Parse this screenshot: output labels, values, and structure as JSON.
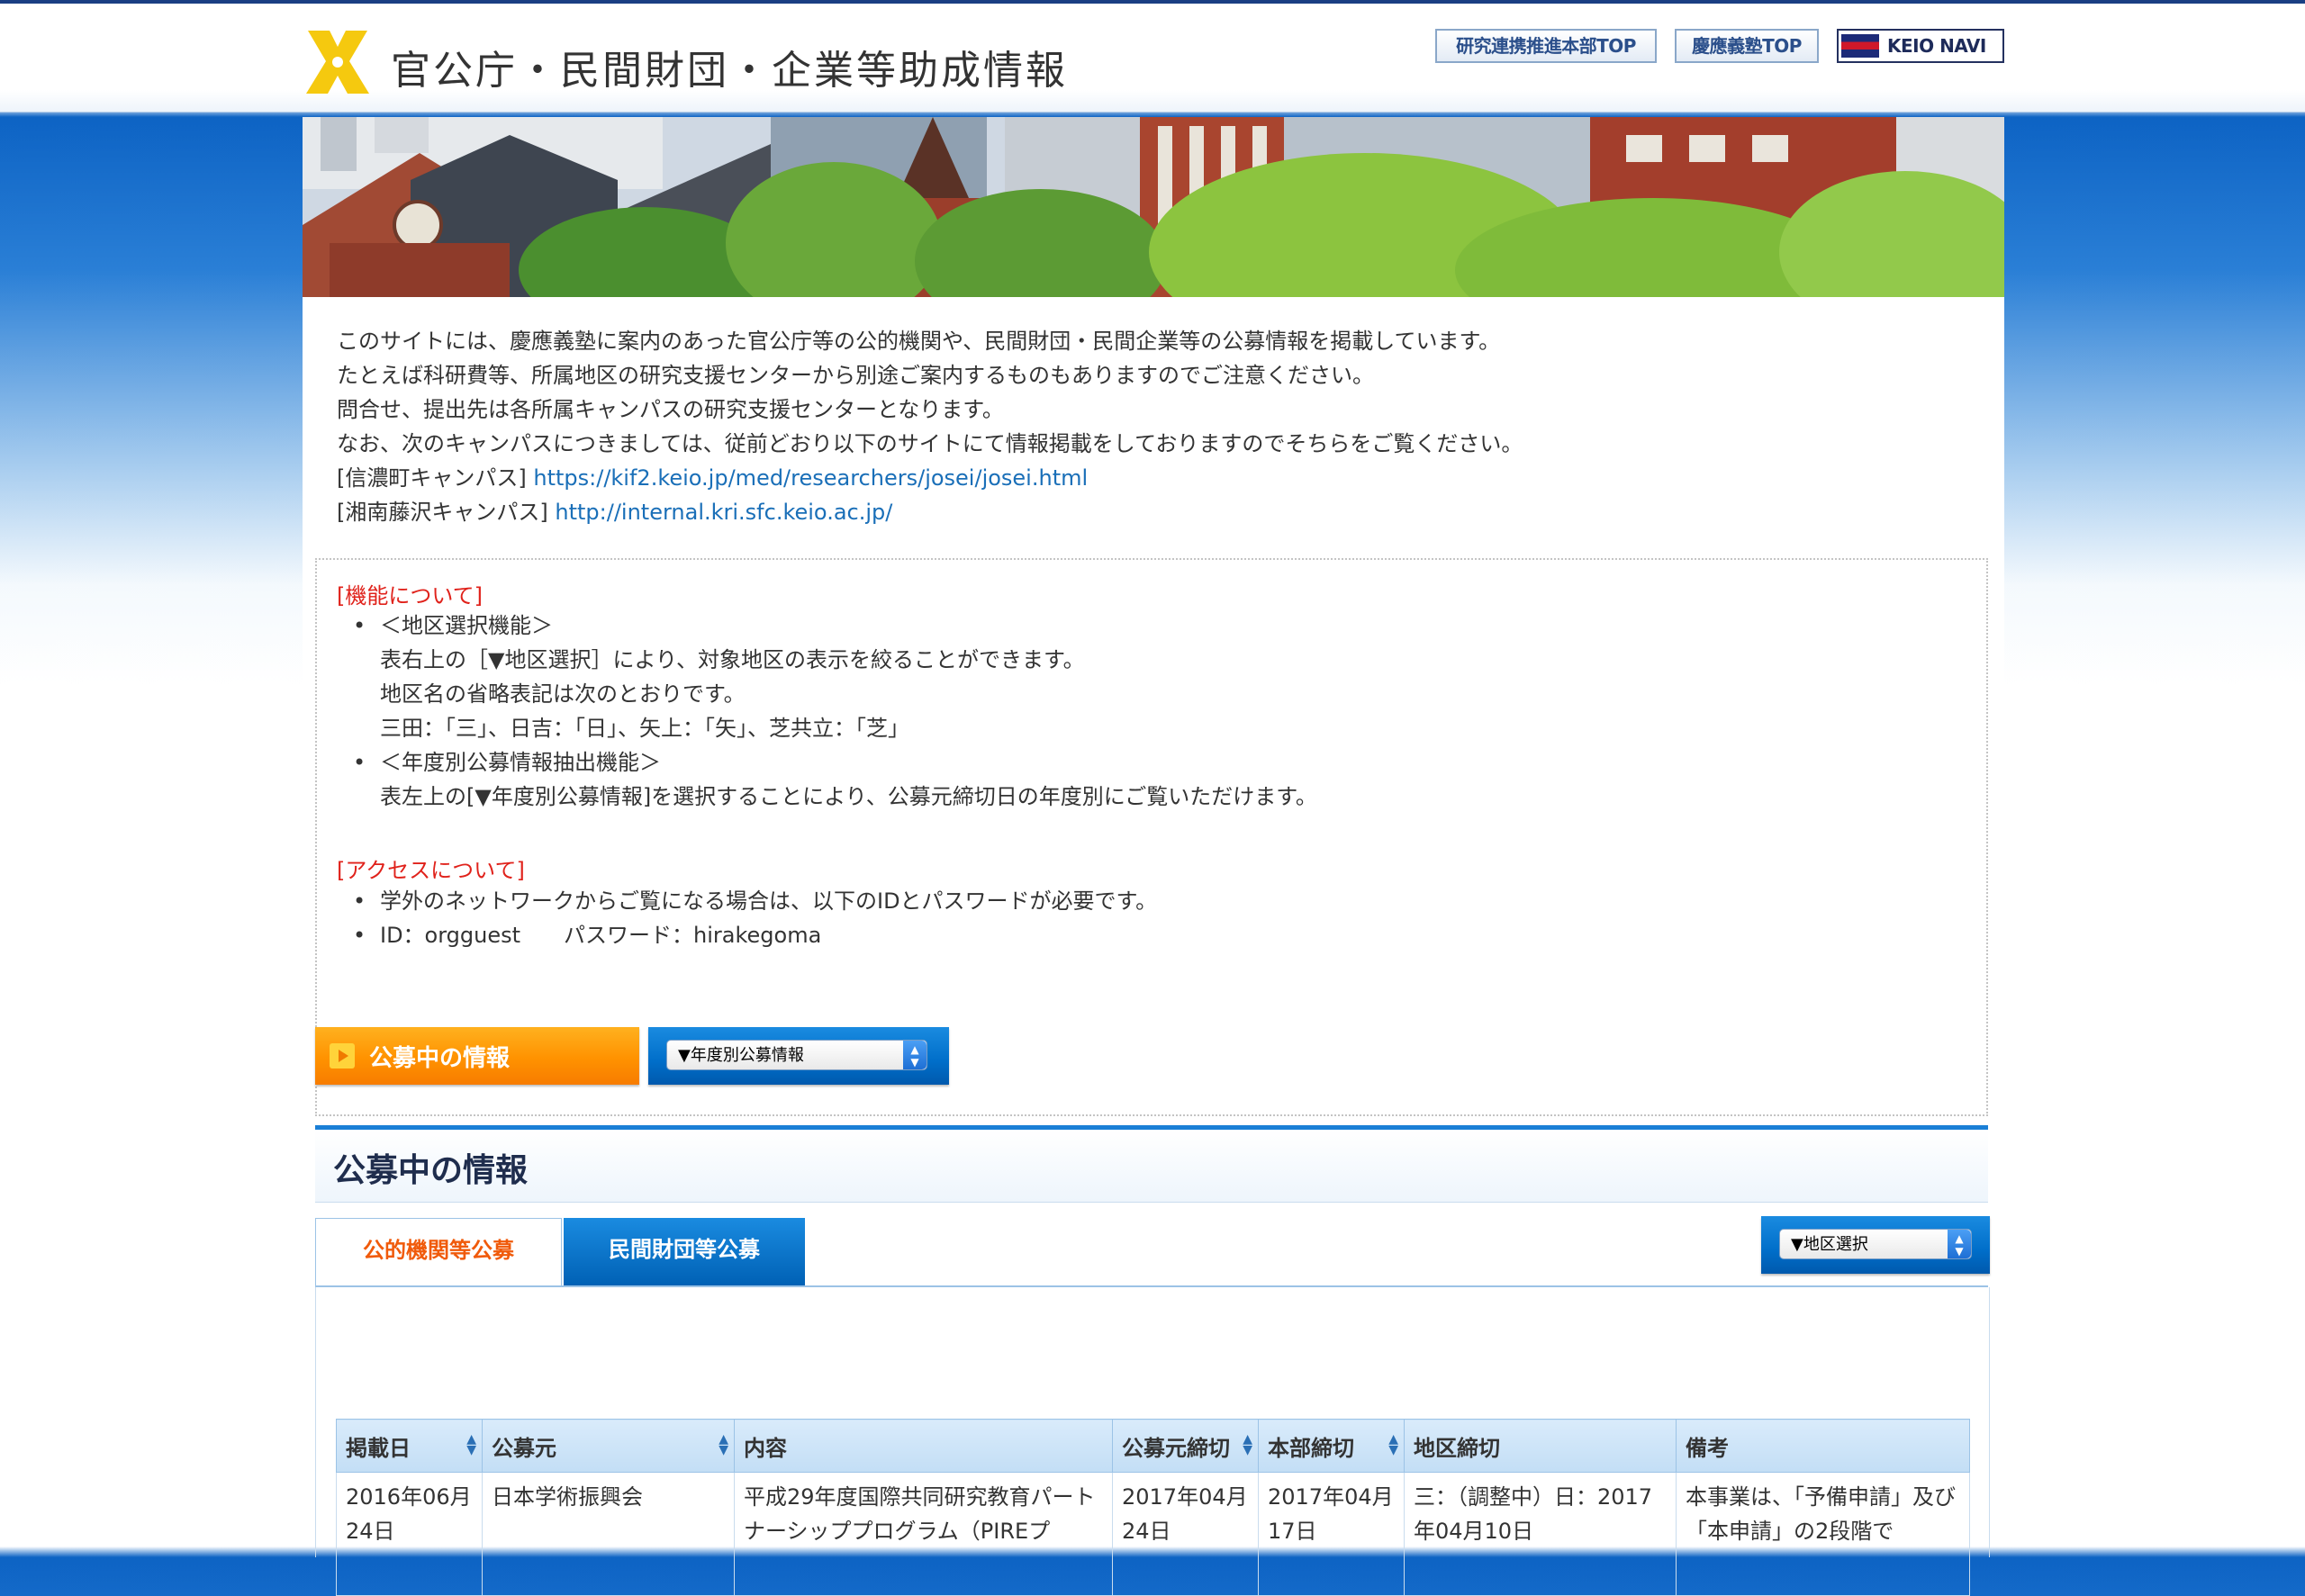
{
  "header": {
    "site_title": "官公庁・民間財団・企業等助成情報",
    "links": {
      "research_top": "研究連携推進本部TOP",
      "keio_top": "慶應義塾TOP",
      "keio_navi": "KEIO NAVI"
    }
  },
  "intro": {
    "lines": [
      "このサイトには、慶應義塾に案内のあった官公庁等の公的機関や、民間財団・民間企業等の公募情報を掲載しています。",
      "たとえば科研費等、所属地区の研究支援センターから別途ご案内するものもありますのでご注意ください。",
      "問合せ、提出先は各所属キャンパスの研究支援センターとなります。",
      "なお、次のキャンパスにつきましては、従前どおり以下のサイトにて情報掲載をしておりますのでそちらをご覧ください。"
    ],
    "campus_links": [
      {
        "label": "[信濃町キャンパス]",
        "url": "https://kif2.keio.jp/med/researchers/josei/josei.html"
      },
      {
        "label": "[湘南藤沢キャンパス]",
        "url": "http://internal.kri.sfc.keio.ac.jp/"
      }
    ]
  },
  "features": {
    "title": "[機能について]",
    "items": [
      {
        "heading": "＜地区選択機能＞",
        "lines": [
          "表右上の［▼地区選択］により、対象地区の表示を絞ることができます。",
          "地区名の省略表記は次のとおりです。",
          "三田：「三」、日吉：「日」、矢上：「矢」、芝共立：「芝」"
        ]
      },
      {
        "heading": "＜年度別公募情報抽出機能＞",
        "lines": [
          "表左上の[▼年度別公募情報]を選択することにより、公募元締切日の年度別にご覧いただけます。"
        ]
      }
    ]
  },
  "access": {
    "title": "[アクセスについて]",
    "items": [
      "学外のネットワークからご覧になる場合は、以下のIDとパスワードが必要です。",
      "ID：orgguest　　パスワード：hirakegoma"
    ]
  },
  "controls": {
    "current_button": "公募中の情報",
    "year_select": "▼年度別公募情報",
    "region_select": "▼地区選択"
  },
  "section": {
    "title": "公募中の情報",
    "tabs": {
      "public": "公的機関等公募",
      "private": "民間財団等公募"
    }
  },
  "table": {
    "headers": [
      "掲載日",
      "公募元",
      "内容",
      "公募元締切",
      "本部締切",
      "地区締切",
      "備考"
    ],
    "rows": [
      [
        "2016年06月24日",
        "日本学術振興会",
        "平成29年度国際共同研究教育パートナーシッププログラム（PIREプ",
        "2017年04月24日",
        "2017年04月17日",
        "三：（調整中）日：2017年04月10日",
        "本事業は、「予備申請」及び「本申請」の2段階で"
      ]
    ]
  },
  "colors": {
    "accent_blue": "#0068c4",
    "accent_orange": "#ff9200",
    "alert_red": "#e0221b",
    "link_blue": "#1a6fb8"
  }
}
